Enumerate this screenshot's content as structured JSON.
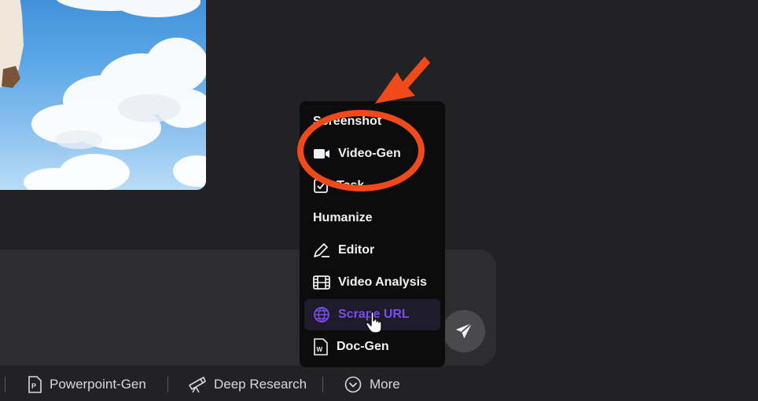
{
  "menu": {
    "items": [
      {
        "label": "Screenshot",
        "icon": "none"
      },
      {
        "label": "Video-Gen",
        "icon": "video-camera-icon"
      },
      {
        "label": "Task",
        "icon": "task-check-icon"
      },
      {
        "label": "Humanize",
        "icon": "none"
      },
      {
        "label": "Editor",
        "icon": "pencil-icon"
      },
      {
        "label": "Video Analysis",
        "icon": "film-strip-icon"
      },
      {
        "label": "Scrape URL",
        "icon": "globe-icon",
        "state": "hovered"
      },
      {
        "label": "Doc-Gen",
        "icon": "word-document-icon"
      }
    ]
  },
  "toolbar": {
    "items": [
      {
        "label": "Powerpoint-Gen",
        "icon": "powerpoint-file-icon"
      },
      {
        "label": "Deep Research",
        "icon": "telescope-icon"
      },
      {
        "label": "More",
        "icon": "chevron-down-circle-icon"
      }
    ]
  },
  "composer": {
    "send_icon": "paper-plane-icon"
  },
  "colors": {
    "background": "#222224",
    "menu_background": "#0c0c0d",
    "hover_accent": "#7b4de8",
    "annotation": "#f04a1a"
  }
}
